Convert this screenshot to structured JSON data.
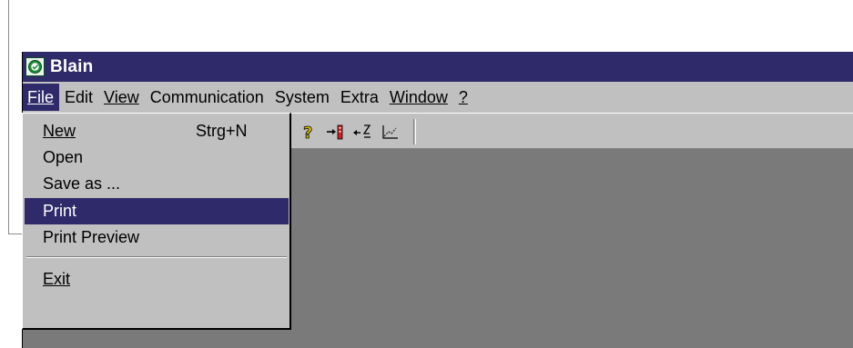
{
  "window": {
    "title": "Blain",
    "icon": "blain-app-icon"
  },
  "menubar": {
    "items": [
      {
        "label": "File",
        "mnemonic": "F"
      },
      {
        "label": "Edit"
      },
      {
        "label": "View",
        "mnemonic": "V"
      },
      {
        "label": "Communication"
      },
      {
        "label": "System"
      },
      {
        "label": "Extra"
      },
      {
        "label": "Window",
        "mnemonic": "W"
      },
      {
        "label": "?",
        "mnemonic": "?"
      }
    ],
    "active": "File"
  },
  "file_menu": {
    "items": [
      {
        "label": "New",
        "shortcut": "Strg+N"
      },
      {
        "label": "Open"
      },
      {
        "label": "Save as ..."
      },
      {
        "label": "Print",
        "highlighted": true
      },
      {
        "label": "Print Preview"
      },
      {
        "label": "Exit"
      }
    ]
  },
  "toolbar": {
    "icons": [
      "help-icon",
      "send-to-device-icon",
      "receive-from-device-icon",
      "trend-chart-icon"
    ]
  },
  "colors": {
    "titlebar": "#2f2a6a",
    "highlight": "#2f2a6a",
    "face": "#c0c0c0",
    "client": "#7a7a7a"
  }
}
